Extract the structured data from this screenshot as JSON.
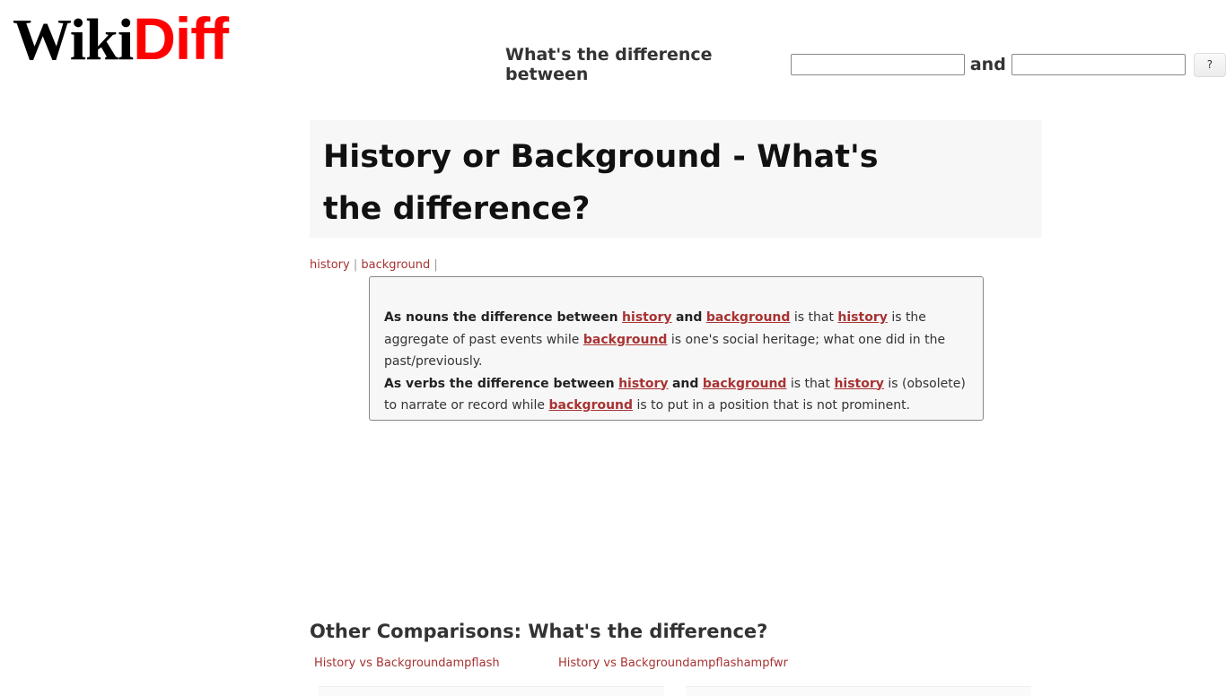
{
  "logo": {
    "part1": "Wiki",
    "part2": "Diff"
  },
  "search": {
    "label": "What's the difference between",
    "and_label": "and",
    "input1_value": "",
    "input2_value": "",
    "button_label": "?"
  },
  "page_title": "History or Background - What's the difference?",
  "breadcrumb": {
    "items": [
      "history",
      "background"
    ],
    "separator": "|"
  },
  "definition": {
    "nouns": {
      "intro": "As nouns the difference between",
      "w1": "history",
      "and": "and",
      "w2": "background",
      "mid": "is that",
      "w3": "history",
      "def1": "is the aggregate of past events while",
      "w4": "background",
      "def2": "is one's social heritage; what one did in the past/previously."
    },
    "verbs": {
      "intro": "As verbs the difference between",
      "w1": "history",
      "and": "and",
      "w2": "background",
      "mid": "is that",
      "w3": "history",
      "def1": "is (obsolete) to narrate or record while",
      "w4": "background",
      "def2": "is to put in a position that is not prominent."
    }
  },
  "other": {
    "heading": "Other Comparisons: What's the difference?",
    "links": [
      "History vs Backgroundampflash",
      "History vs Backgroundampflashampfwr"
    ]
  },
  "colors": {
    "link": "#a83232",
    "logo_red": "#ff0000"
  }
}
